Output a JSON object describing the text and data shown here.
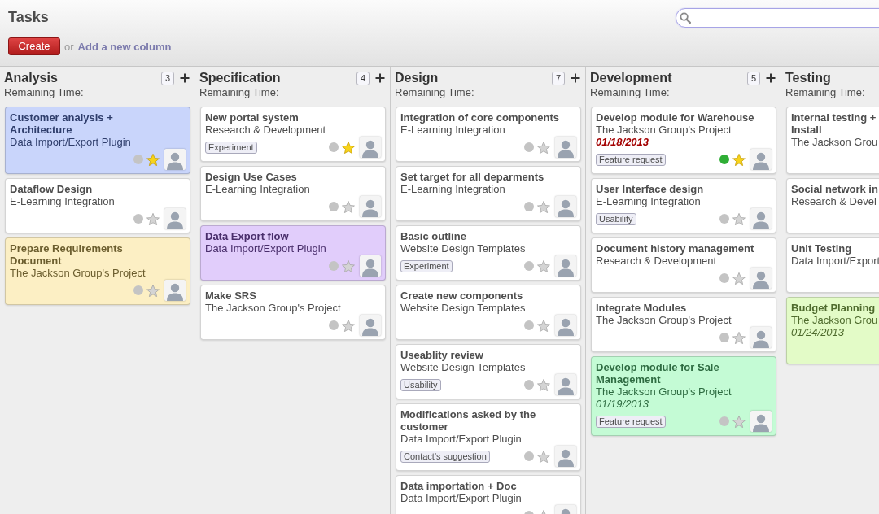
{
  "header": {
    "title": "Tasks",
    "search": {
      "focused": true
    },
    "create_button": "Create",
    "or_text": "or",
    "add_column_link": "Add a new column"
  },
  "columns": [
    {
      "title": "Analysis",
      "count": "3",
      "remaining_time_label": "Remaining Time:",
      "cards": [
        {
          "title": "Customer analysis + Architecture",
          "project": "Data Import/Export Plugin",
          "color": "#c9d5fb",
          "ready": false,
          "starred": true,
          "assignee_avatar": true
        },
        {
          "title": "Dataflow Design",
          "project": "E-Learning Integration",
          "color": "#ffffff",
          "ready": false,
          "starred": false,
          "assignee_avatar": true
        },
        {
          "title": "Prepare Requirements Document",
          "project": "The Jackson Group's Project",
          "color": "#fcefc4",
          "ready": false,
          "starred": false,
          "assignee_avatar": true
        }
      ]
    },
    {
      "title": "Specification",
      "count": "4",
      "remaining_time_label": "Remaining Time:",
      "cards": [
        {
          "title": "New portal system",
          "project": "Research & Development",
          "color": "#ffffff",
          "tags": [
            "Experiment"
          ],
          "ready": false,
          "starred": true,
          "assignee_avatar": true
        },
        {
          "title": "Design Use Cases",
          "project": "E-Learning Integration",
          "color": "#ffffff",
          "ready": false,
          "starred": false,
          "assignee_avatar": true
        },
        {
          "title": "Data Export flow",
          "project": "Data Import/Export Plugin",
          "color": "#e1cdfb",
          "ready": false,
          "starred": false,
          "assignee_avatar": true
        },
        {
          "title": "Make SRS",
          "project": "The Jackson Group's Project",
          "color": "#ffffff",
          "ready": false,
          "starred": false,
          "assignee_avatar": true
        }
      ]
    },
    {
      "title": "Design",
      "count": "7",
      "remaining_time_label": "Remaining Time:",
      "cards": [
        {
          "title": "Integration of core components",
          "project": "E-Learning Integration",
          "color": "#ffffff",
          "ready": false,
          "starred": false,
          "assignee_avatar": true
        },
        {
          "title": "Set target for all deparments",
          "project": "E-Learning Integration",
          "color": "#ffffff",
          "ready": false,
          "starred": false,
          "assignee_avatar": true
        },
        {
          "title": "Basic outline",
          "project": "Website Design Templates",
          "color": "#ffffff",
          "tags": [
            "Experiment"
          ],
          "ready": false,
          "starred": false,
          "assignee_avatar": true
        },
        {
          "title": "Create new components",
          "project": "Website Design Templates",
          "color": "#ffffff",
          "ready": false,
          "starred": false,
          "assignee_avatar": true
        },
        {
          "title": "Useablity review",
          "project": "Website Design Templates",
          "color": "#ffffff",
          "tags": [
            "Usability"
          ],
          "ready": false,
          "starred": false,
          "assignee_avatar": true
        },
        {
          "title": "Modifications asked by the customer",
          "project": "Data Import/Export Plugin",
          "color": "#ffffff",
          "tags": [
            "Contact's suggestion"
          ],
          "ready": false,
          "starred": false,
          "assignee_avatar": true
        },
        {
          "title": "Data importation + Doc",
          "project": "Data Import/Export Plugin",
          "color": "#ffffff",
          "ready": false,
          "starred": false,
          "assignee_avatar": true
        }
      ]
    },
    {
      "title": "Development",
      "count": "5",
      "remaining_time_label": "Remaining Time:",
      "cards": [
        {
          "title": "Develop module for Warehouse",
          "project": "The Jackson Group's Project",
          "color": "#ffffff",
          "deadline": {
            "text": "01/18/2013",
            "overdue": true
          },
          "tags": [
            "Feature request"
          ],
          "ready": true,
          "starred": true,
          "assignee_avatar": true
        },
        {
          "title": "User Interface design",
          "project": "E-Learning Integration",
          "color": "#ffffff",
          "tags": [
            "Usability"
          ],
          "ready": false,
          "starred": false,
          "assignee_avatar": true
        },
        {
          "title": "Document history management",
          "project": "Research & Development",
          "color": "#ffffff",
          "ready": false,
          "starred": false,
          "assignee_avatar": true
        },
        {
          "title": "Integrate Modules",
          "project": "The Jackson Group's Project",
          "color": "#ffffff",
          "ready": false,
          "starred": false,
          "assignee_avatar": true
        },
        {
          "title": "Develop module for Sale Management",
          "project": "The Jackson Group's Project",
          "color": "#c4fbd5",
          "deadline": {
            "text": "01/19/2013",
            "overdue": false
          },
          "tags": [
            "Feature request"
          ],
          "ready": false,
          "starred": false,
          "assignee_avatar": true
        }
      ]
    },
    {
      "title": "Testing",
      "remaining_time_label": "Remaining Time:",
      "cards": [
        {
          "title": "Internal testing +\nInstall",
          "project": "The Jackson Grou",
          "color": "#ffffff"
        },
        {
          "title": "Social network in",
          "project": "Research & Devel",
          "color": "#ffffff"
        },
        {
          "title": "Unit Testing",
          "project": "Data Import/Export",
          "color": "#ffffff"
        },
        {
          "title": "Budget Planning",
          "project": "The Jackson Grou",
          "color": "#e3fbc7",
          "deadline": {
            "text": "01/24/2013",
            "overdue": false
          }
        }
      ]
    }
  ]
}
